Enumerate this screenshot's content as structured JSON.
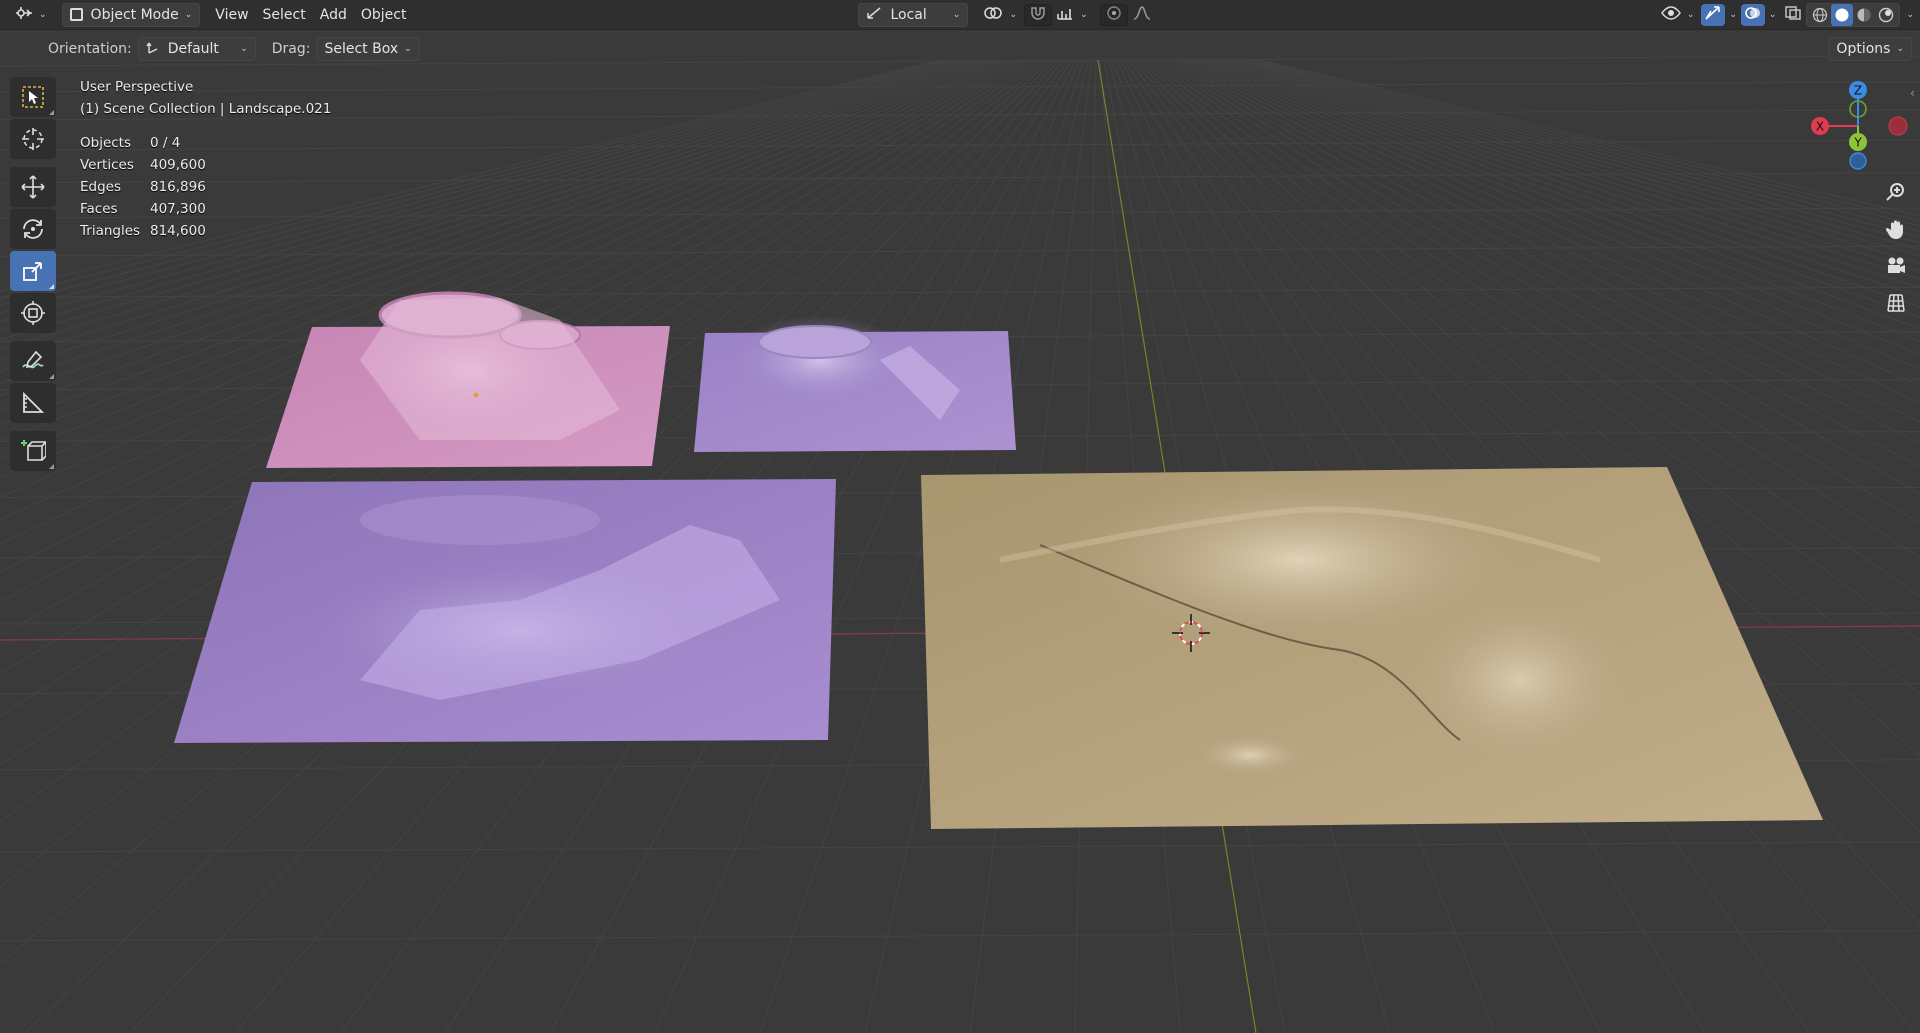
{
  "header": {
    "mode_label": "Object Mode",
    "menus": [
      "View",
      "Select",
      "Add",
      "Object"
    ],
    "transform_orientation": "Local",
    "options_label": "Options"
  },
  "tool_settings": {
    "orientation_label": "Orientation:",
    "orientation_value": "Default",
    "drag_label": "Drag:",
    "drag_value": "Select Box"
  },
  "overlay": {
    "view_name": "User Perspective",
    "collection": "(1) Scene Collection | Landscape.021",
    "stats": [
      {
        "key": "Objects",
        "value": "0 / 4"
      },
      {
        "key": "Vertices",
        "value": "409,600"
      },
      {
        "key": "Edges",
        "value": "816,896"
      },
      {
        "key": "Faces",
        "value": "407,300"
      },
      {
        "key": "Triangles",
        "value": "814,600"
      }
    ]
  },
  "gizmo": {
    "x_label": "X",
    "y_label": "Y",
    "z_label": "Z"
  },
  "colors": {
    "accent": "#4772b3",
    "axis_x": "#e03c4e",
    "axis_y": "#8cc43a",
    "axis_z": "#3a8ce0",
    "landscape_pink": "#c98cb8",
    "landscape_lilac": "#a58ac8",
    "landscape_purple": "#9c82c4",
    "landscape_tan": "#b09e7e"
  },
  "toolbar_icons": [
    "select-box-icon",
    "cursor-icon",
    "move-icon",
    "rotate-icon",
    "scale-icon",
    "transform-icon",
    "annotate-icon",
    "measure-icon",
    "add-cube-icon"
  ],
  "nav_icons": [
    "zoom-icon",
    "pan-hand-icon",
    "camera-icon",
    "ortho-grid-icon"
  ]
}
